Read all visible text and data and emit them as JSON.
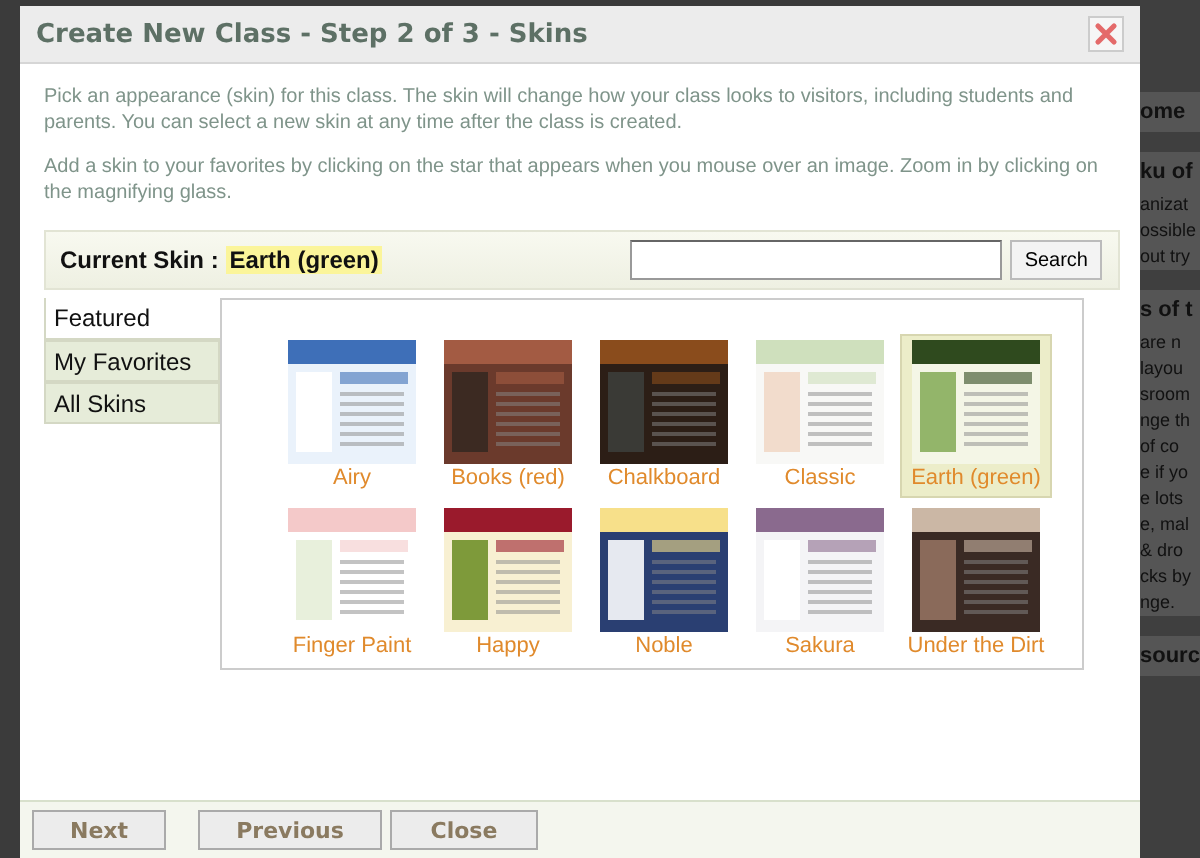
{
  "dialog": {
    "title": "Create New Class - Step 2 of 3 - Skins",
    "intro": "Pick an appearance (skin) for this class. The skin will change how your class looks to visitors, including students and parents. You can select a new skin at any time after the class is created.",
    "hint": "Add a skin to your favorites by clicking on the star that appears when you mouse over an image. Zoom in by clicking on the magnifying glass.",
    "current_skin": {
      "label": "Current Skin",
      "separator": ":",
      "value": "Earth (green)"
    },
    "search": {
      "button": "Search"
    },
    "tabs": [
      {
        "label": "Featured",
        "selected": true
      },
      {
        "label": "My Favorites",
        "selected": false
      },
      {
        "label": "All Skins",
        "selected": false
      }
    ],
    "skins": [
      {
        "name": "Airy",
        "selected": false
      },
      {
        "name": "Books (red)",
        "selected": false
      },
      {
        "name": "Chalkboard",
        "selected": false
      },
      {
        "name": "Classic",
        "selected": false
      },
      {
        "name": "Earth (green)",
        "selected": true
      },
      {
        "name": "Finger Paint",
        "selected": false
      },
      {
        "name": "Happy",
        "selected": false
      },
      {
        "name": "Noble",
        "selected": false
      },
      {
        "name": "Sakura",
        "selected": false
      },
      {
        "name": "Under the Dirt",
        "selected": false
      }
    ],
    "buttons": [
      "Next",
      "Previous",
      "Close"
    ]
  },
  "background_page": {
    "lines": [
      {
        "text": "ome",
        "kind": "heading"
      },
      {
        "text": "ku of",
        "kind": "heading"
      },
      {
        "text": "anizat",
        "kind": "body"
      },
      {
        "text": "ossible",
        "kind": "body"
      },
      {
        "text": "out try",
        "kind": "body"
      },
      {
        "text": "s of t",
        "kind": "heading"
      },
      {
        "text": "are n",
        "kind": "body"
      },
      {
        "text": "layou",
        "kind": "body"
      },
      {
        "text": "sroom",
        "kind": "body"
      },
      {
        "text": "nge th",
        "kind": "body"
      },
      {
        "text": "of co",
        "kind": "body"
      },
      {
        "text": "e if yo",
        "kind": "body"
      },
      {
        "text": "e lots",
        "kind": "body"
      },
      {
        "text": "e, mal",
        "kind": "body"
      },
      {
        "text": "& dro",
        "kind": "body"
      },
      {
        "text": "cks by",
        "kind": "body"
      },
      {
        "text": "nge.",
        "kind": "body"
      },
      {
        "text": "sourc",
        "kind": "heading"
      }
    ]
  }
}
